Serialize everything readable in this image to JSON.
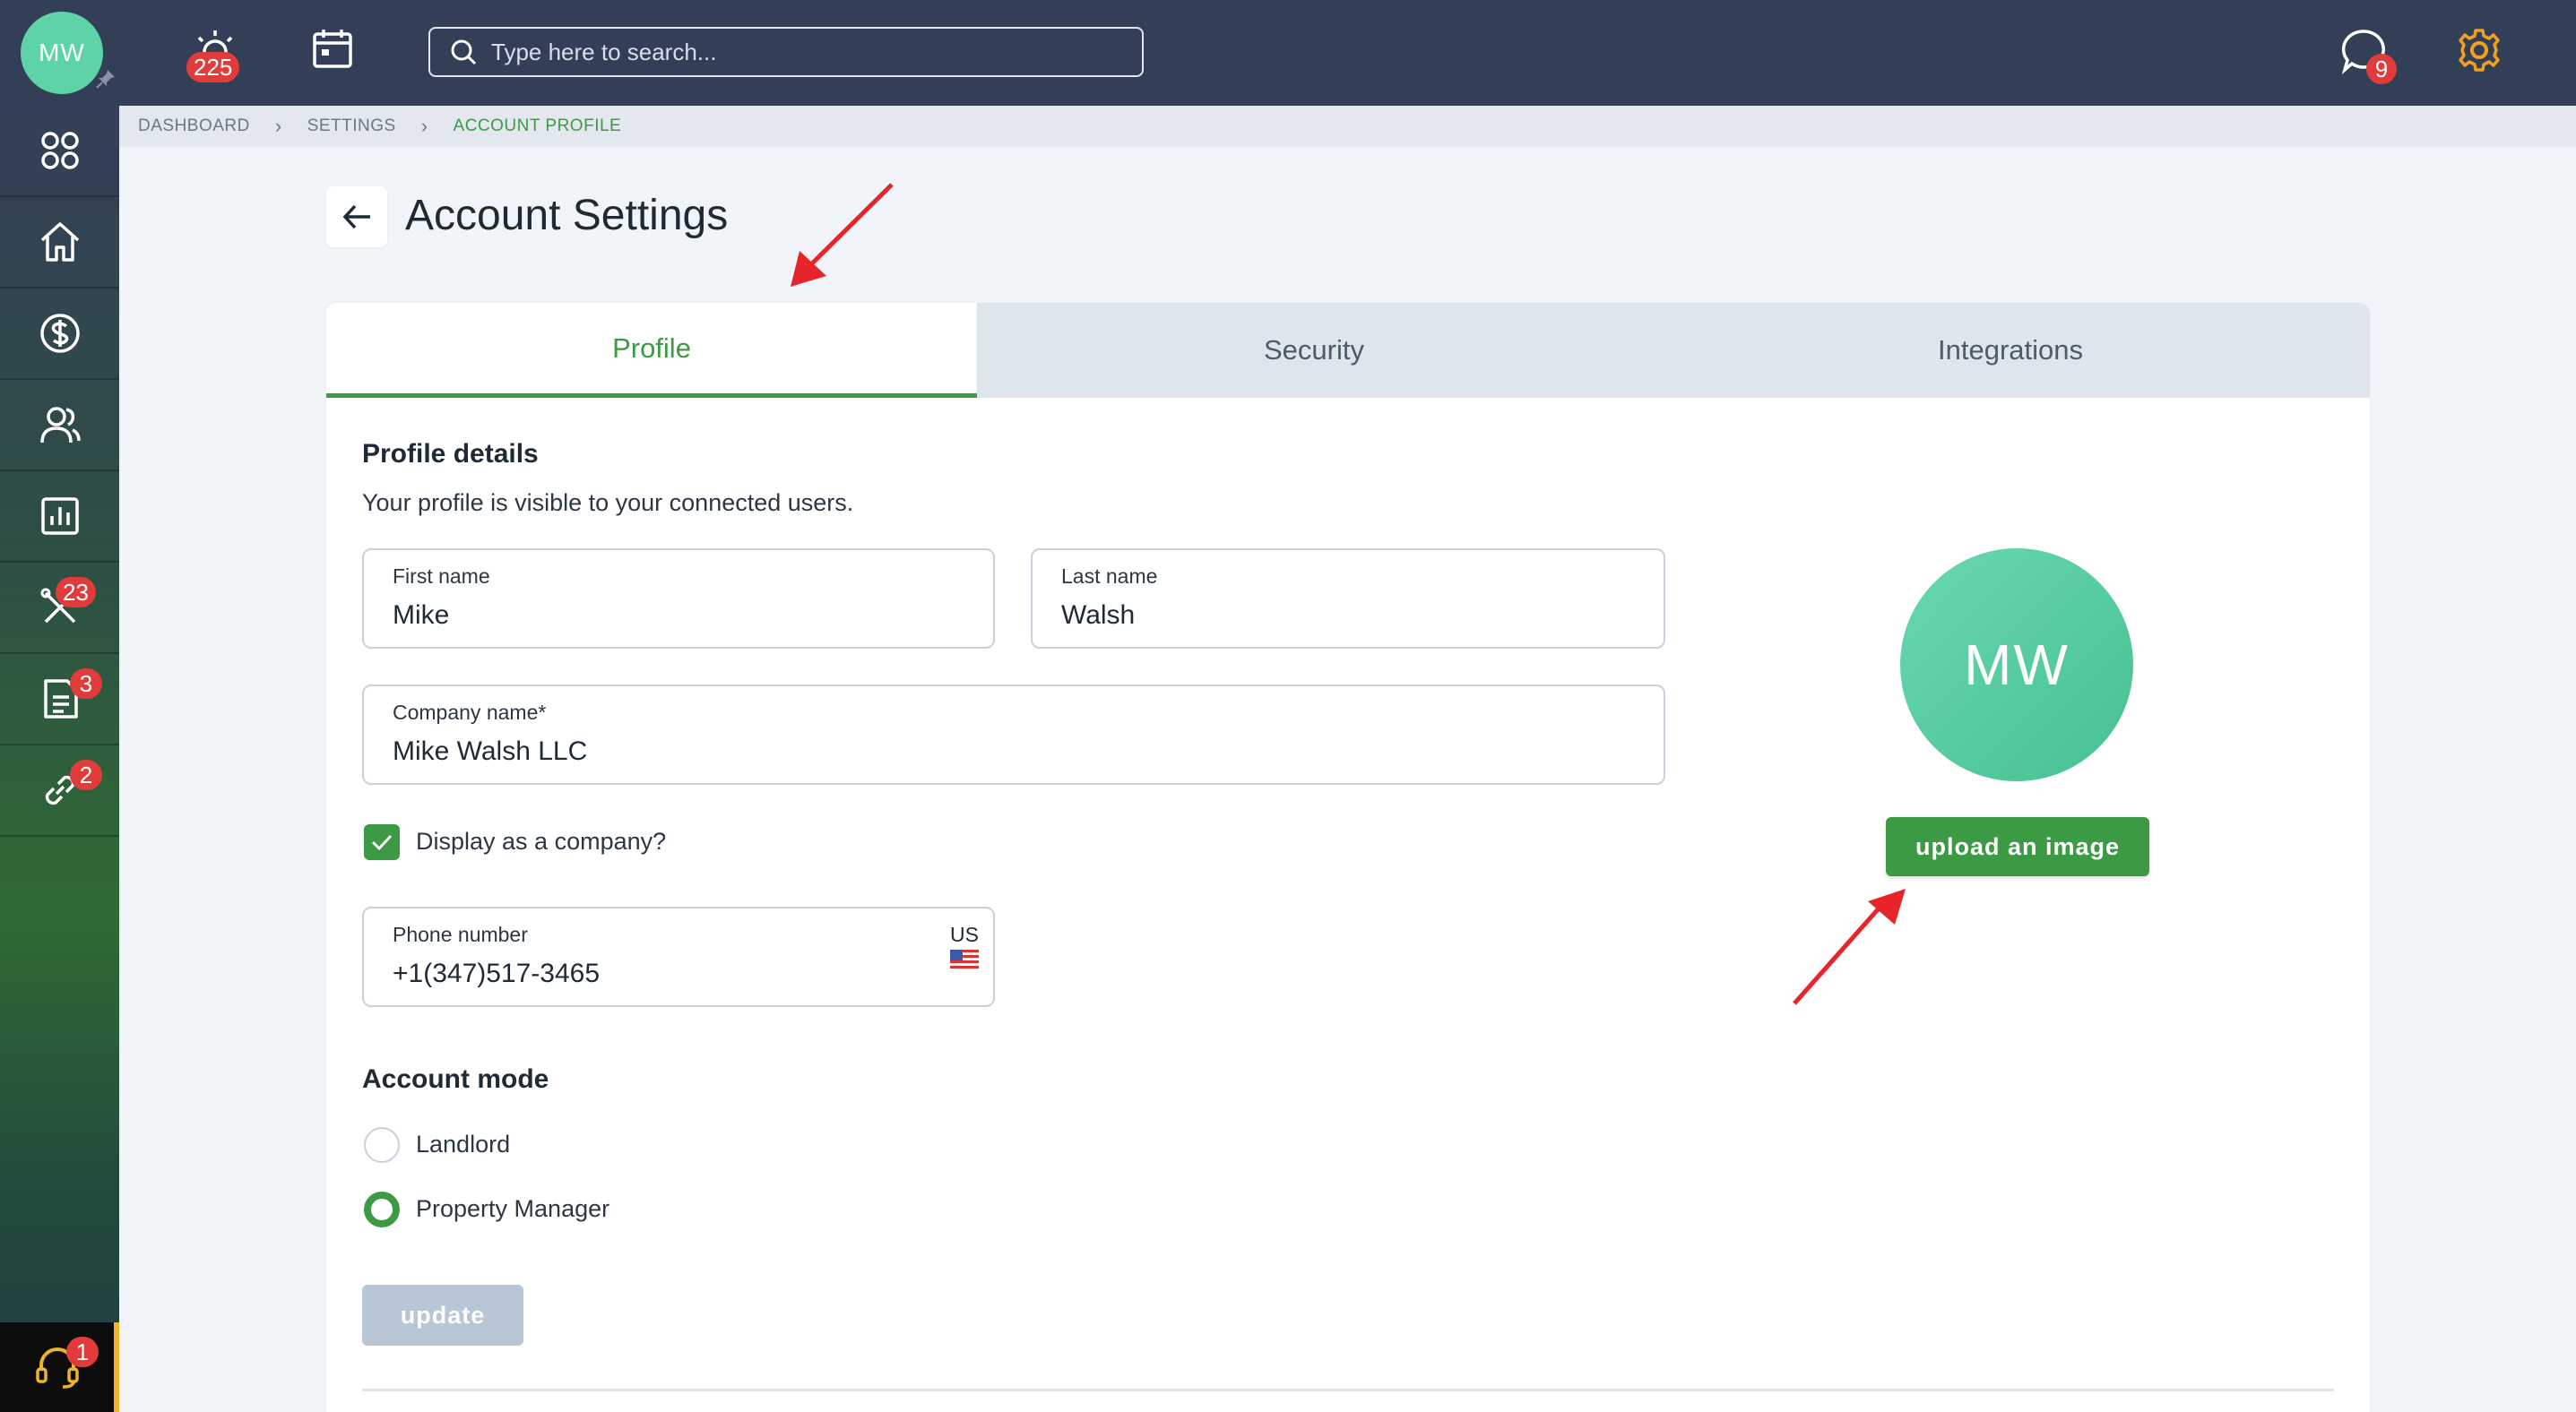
{
  "topbar": {
    "avatar_initials": "MW",
    "alerts_count": "225",
    "messages_count": "9",
    "search_placeholder": "Type here to search..."
  },
  "sidebar": {
    "items": [
      {
        "name": "apps",
        "icon": "grid-icon"
      },
      {
        "name": "home",
        "icon": "home-icon"
      },
      {
        "name": "finance",
        "icon": "dollar-icon"
      },
      {
        "name": "contacts",
        "icon": "users-icon"
      },
      {
        "name": "reports",
        "icon": "chart-icon"
      },
      {
        "name": "maintenance",
        "icon": "tools-icon",
        "badge": "23"
      },
      {
        "name": "documents",
        "icon": "document-icon",
        "badge": "3"
      },
      {
        "name": "links",
        "icon": "link-icon",
        "badge": "2"
      }
    ],
    "help_badge": "1"
  },
  "breadcrumb": {
    "items": [
      "DASHBOARD",
      "SETTINGS",
      "ACCOUNT PROFILE"
    ]
  },
  "page": {
    "title": "Account Settings"
  },
  "tabs": [
    "Profile",
    "Security",
    "Integrations"
  ],
  "profile": {
    "section_title": "Profile details",
    "section_subtitle": "Your profile is visible to your connected users.",
    "first_name_label": "First name",
    "first_name": "Mike",
    "last_name_label": "Last name",
    "last_name": "Walsh",
    "company_label": "Company name*",
    "company": "Mike Walsh LLC",
    "display_company_label": "Display as a company?",
    "display_company_checked": true,
    "phone_label": "Phone number",
    "phone": "+1(347)517-3465",
    "phone_country": "US",
    "account_mode_title": "Account mode",
    "account_modes": [
      "Landlord",
      "Property Manager"
    ],
    "selected_mode": "Property Manager",
    "update_label": "update",
    "avatar_initials": "MW",
    "upload_label": "upload an image"
  },
  "colors": {
    "topbar": "#333f57",
    "accent_green": "#3c9a44",
    "badge_red": "#e23b3b",
    "annotation_red": "#e8242b",
    "settings_orange": "#f0a020"
  }
}
